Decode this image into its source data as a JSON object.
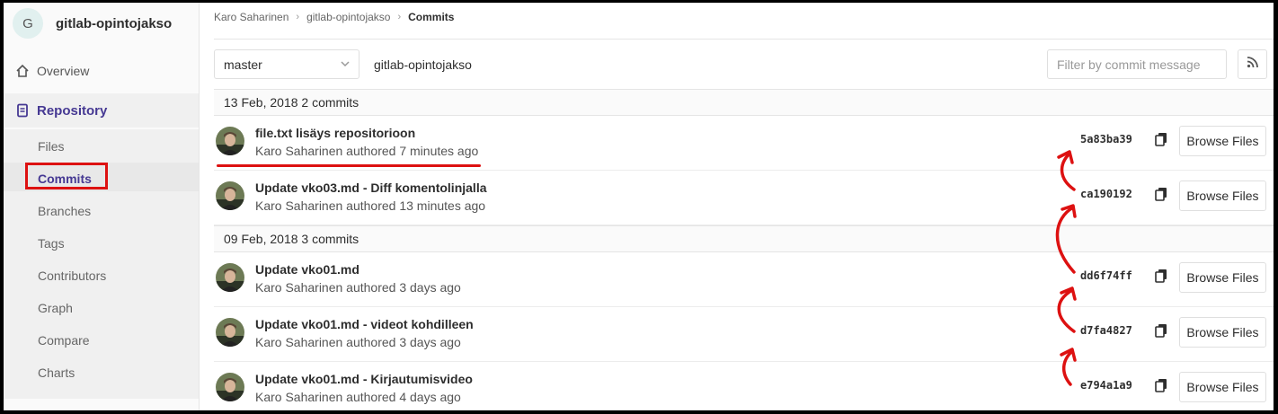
{
  "sidebar": {
    "project_initial": "G",
    "project_name": "gitlab-opintojakso",
    "overview": "Overview",
    "repository": "Repository",
    "sub_items": [
      "Files",
      "Commits",
      "Branches",
      "Tags",
      "Contributors",
      "Graph",
      "Compare",
      "Charts"
    ]
  },
  "breadcrumb": [
    "Karo Saharinen",
    "gitlab-opintojakso",
    "Commits"
  ],
  "toolbar": {
    "branch": "master",
    "project_path": "gitlab-opintojakso",
    "filter_placeholder": "Filter by commit message"
  },
  "days": [
    {
      "label": "13 Feb, 2018 2 commits",
      "commits": [
        {
          "title": "file.txt lisäys repositorioon",
          "meta": "Karo Saharinen authored 7 minutes ago",
          "sha": "5a83ba39"
        },
        {
          "title": "Update vko03.md - Diff komentolinjalla",
          "meta": "Karo Saharinen authored 13 minutes ago",
          "sha": "ca190192"
        }
      ]
    },
    {
      "label": "09 Feb, 2018 3 commits",
      "commits": [
        {
          "title": "Update vko01.md",
          "meta": "Karo Saharinen authored 3 days ago",
          "sha": "dd6f74ff"
        },
        {
          "title": "Update vko01.md - videot kohdilleen",
          "meta": "Karo Saharinen authored 3 days ago",
          "sha": "d7fa4827"
        },
        {
          "title": "Update vko01.md - Kirjautumisvideo",
          "meta": "Karo Saharinen authored 4 days ago",
          "sha": "e794a1a9"
        }
      ]
    }
  ],
  "browse_label": "Browse Files",
  "colors": {
    "annotation": "#dd1111",
    "accent": "#463993"
  }
}
